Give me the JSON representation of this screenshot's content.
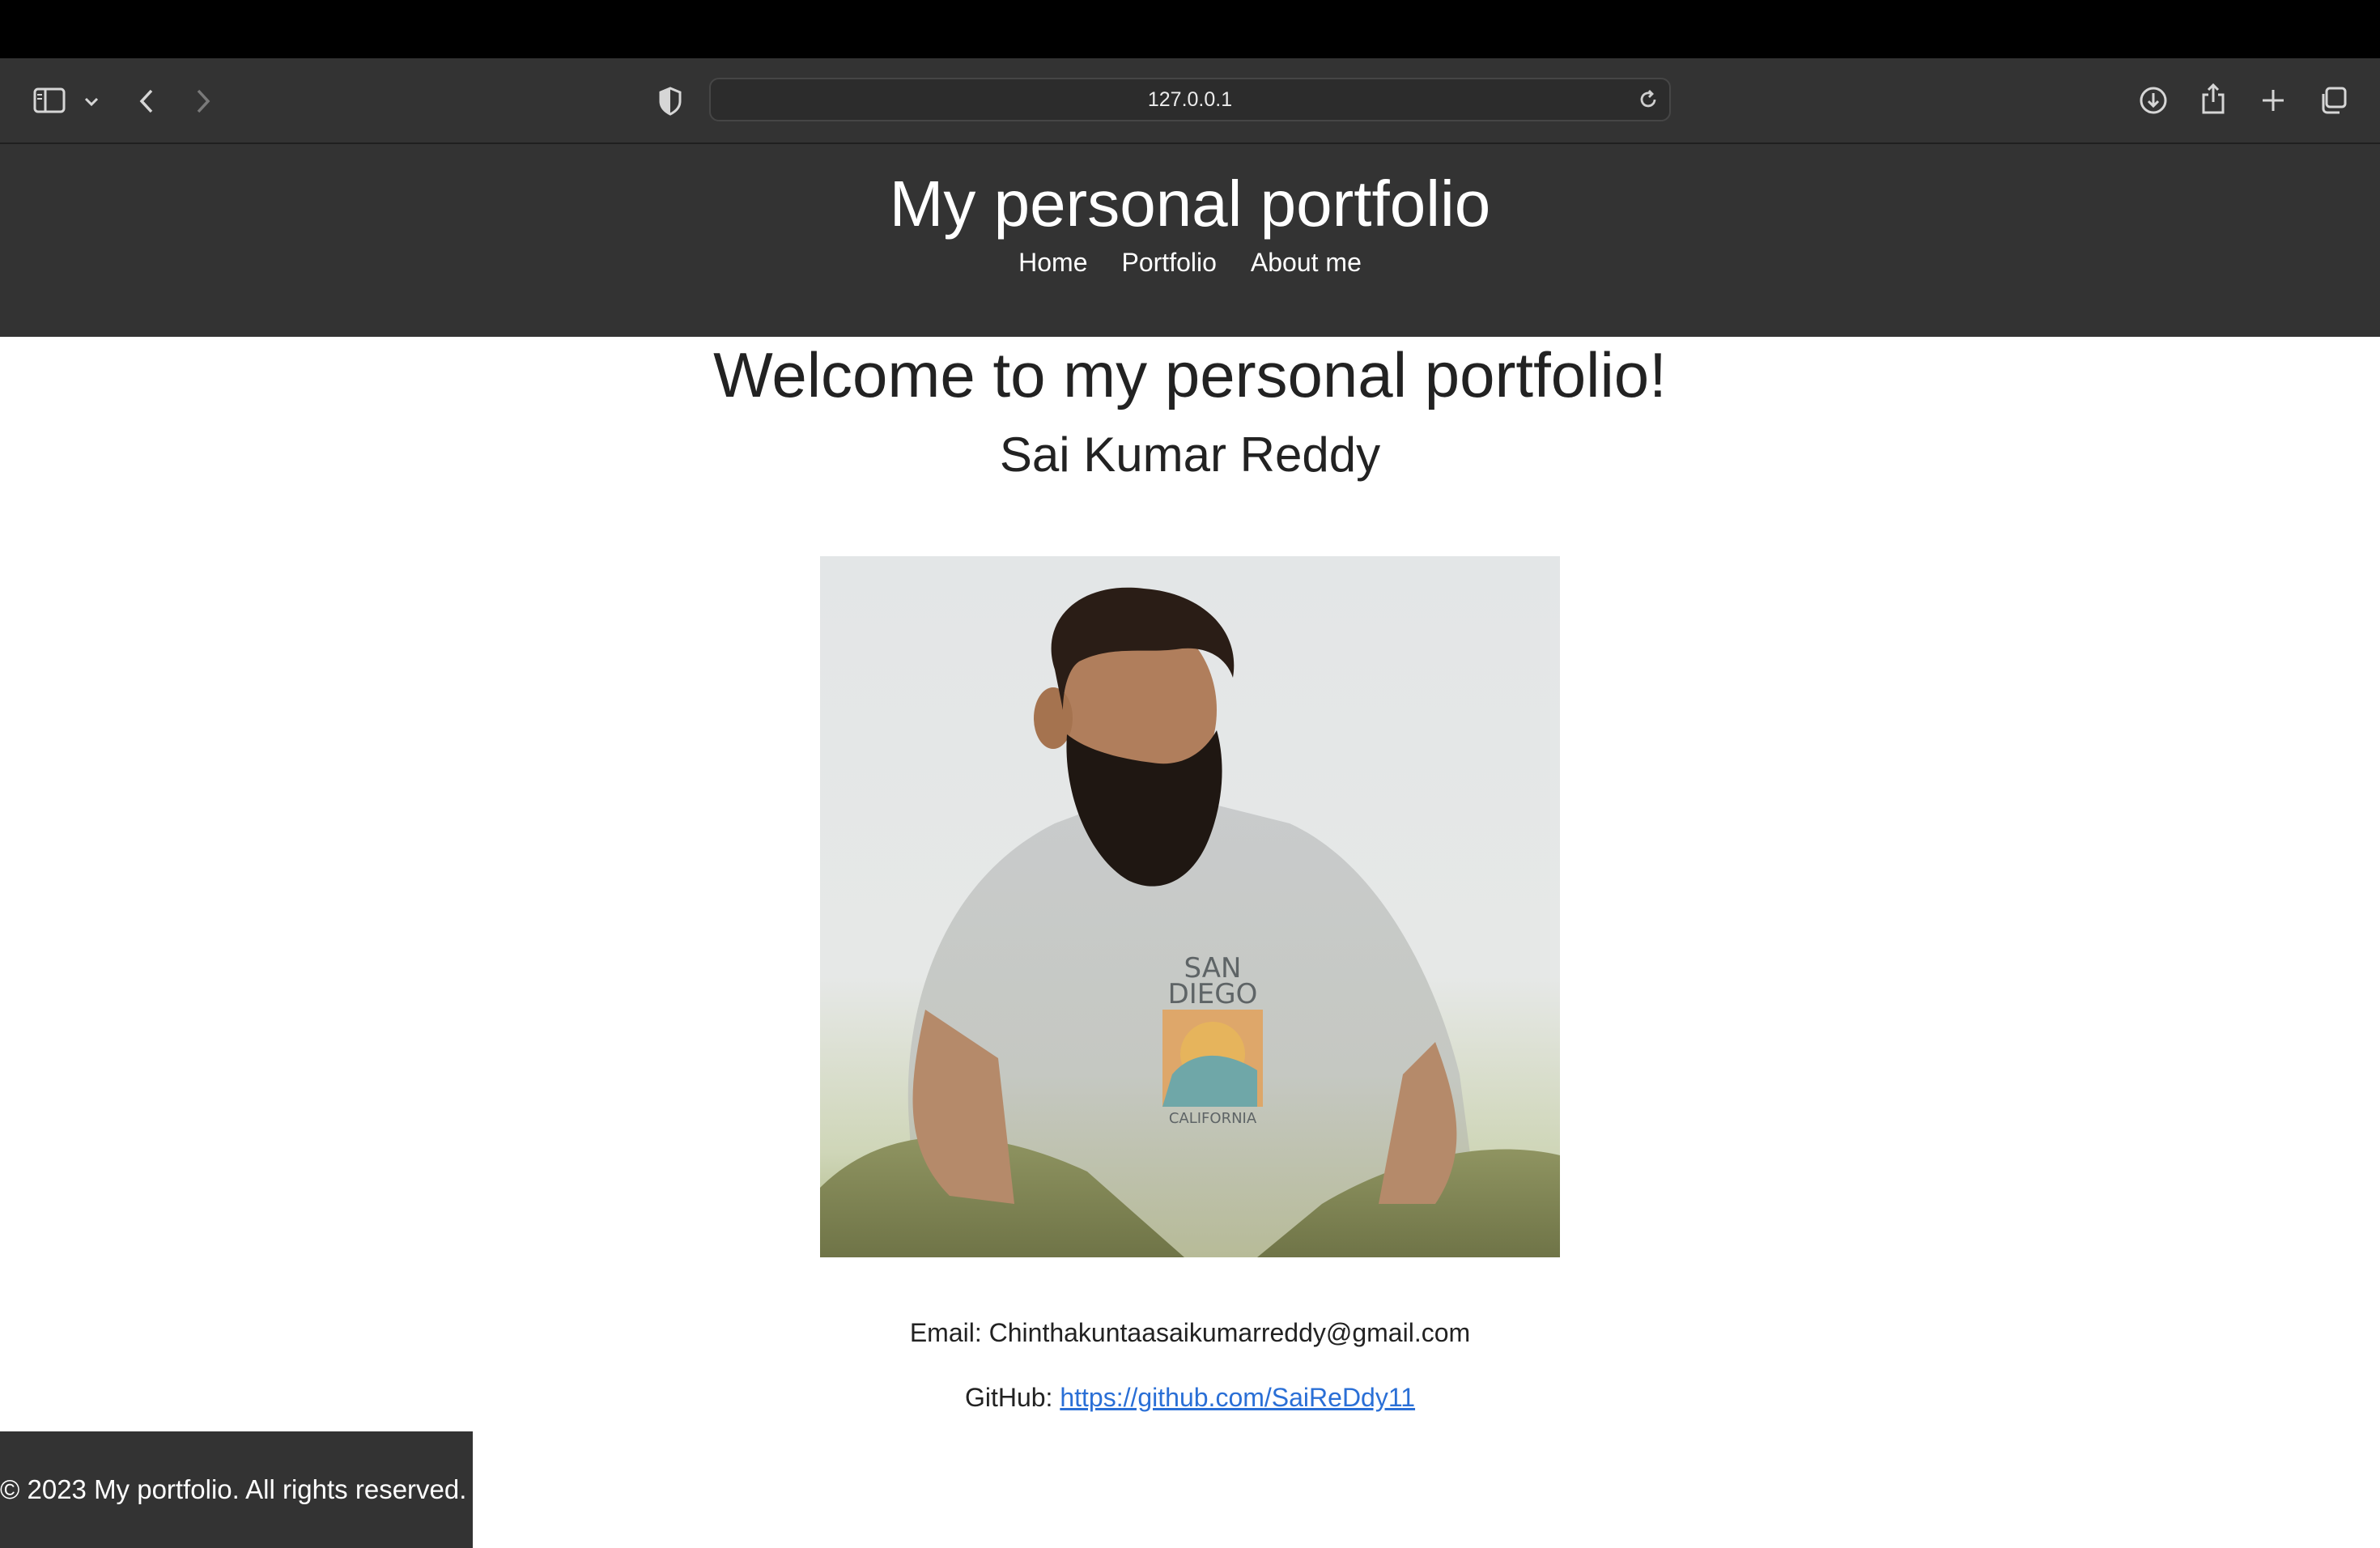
{
  "browser": {
    "url": "127.0.0.1",
    "icons": [
      "sidebar-icon",
      "chevron-down-icon",
      "back-icon",
      "forward-icon",
      "shield-icon",
      "reload-icon",
      "download-icon",
      "share-icon",
      "new-tab-icon",
      "tabs-overview-icon"
    ]
  },
  "header": {
    "title": "My personal portfolio",
    "nav": [
      "Home",
      "Portfolio",
      "About me"
    ]
  },
  "main": {
    "heading": "Welcome to my personal portfolio!",
    "name": "Sai Kumar Reddy",
    "photo_shirt_text": [
      "SAN",
      "DIEGO",
      "CALIFORNIA"
    ],
    "email_label": "Email:",
    "email": "Chinthakuntaasaikumarreddy@gmail.com",
    "github_label": "GitHub:",
    "github_url": "https://github.com/SaiReDdy11"
  },
  "footer": {
    "text": "© 2023 My portfolio. All rights reserved."
  },
  "colors": {
    "header_bg": "#333333",
    "link": "#2a6fd6",
    "text": "#222222"
  }
}
